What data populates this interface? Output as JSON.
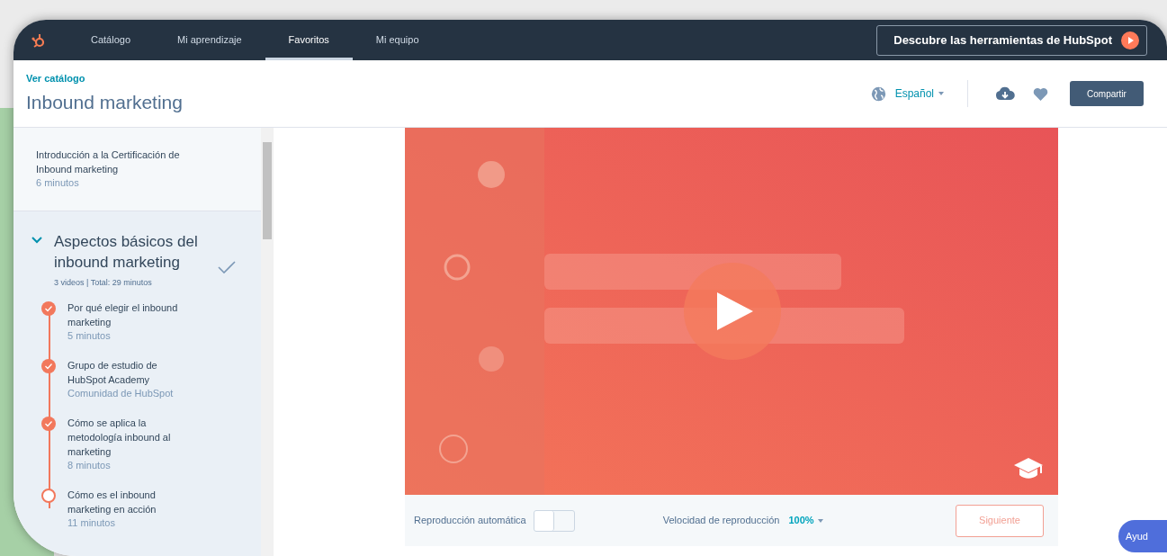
{
  "nav": {
    "items": [
      {
        "label": "Catálogo",
        "selected": false
      },
      {
        "label": "Mi aprendizaje",
        "selected": false
      },
      {
        "label": "Favoritos",
        "selected": true
      },
      {
        "label": "Mi equipo",
        "selected": false
      }
    ],
    "cta": "Descubre las herramientas de HubSpot"
  },
  "header": {
    "breadcrumb": "Ver catálogo",
    "title": "Inbound marketing",
    "language": "Español",
    "share": "Compartir"
  },
  "sidebar": {
    "intro": {
      "title": "Introducción a la Certificación de Inbound marketing",
      "meta": "6 minutos"
    },
    "section": {
      "title": "Aspectos básicos del inbound marketing",
      "meta": "3 videos | Total: 29 minutos",
      "expanded": true,
      "completed": true,
      "lessons": [
        {
          "title": "Por qué elegir el inbound marketing",
          "meta": "5 minutos",
          "completed": true
        },
        {
          "title": "Grupo de estudio de HubSpot Academy",
          "meta": "Comunidad de HubSpot",
          "completed": true
        },
        {
          "title": "Cómo se aplica la metodología inbound al marketing",
          "meta": "8 minutos",
          "completed": true
        },
        {
          "title": "Cómo es el inbound marketing en acción",
          "meta": "11 minutos",
          "completed": false
        }
      ]
    }
  },
  "player": {
    "autoplay_label": "Reproducción automática",
    "autoplay": false,
    "speed_label": "Velocidad de reproducción",
    "speed": "100%",
    "next": "Siguiente"
  },
  "help": "Ayud"
}
